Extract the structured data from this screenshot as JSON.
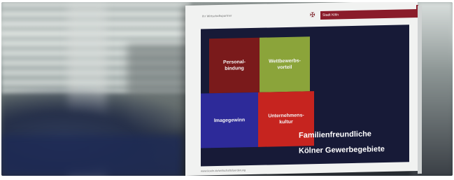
{
  "monitor": {
    "top_label": "Ihr Wirtschaftspartner",
    "brand": "Stadt Köln",
    "footer": "www.koeln.de/wirtschaftsfoerderung"
  },
  "tiles": [
    {
      "label": "Personal-\nbindung"
    },
    {
      "label": "Wettbewerbs-\nvorteil"
    },
    {
      "label": "Imagegewinn"
    },
    {
      "label": "Unternehmens-\nkultur"
    }
  ],
  "headline": {
    "line1": "Familienfreundliche",
    "line2": "Kölner Gewerbegebiete"
  },
  "colors": {
    "tile_red_dark": "#7a1a1b",
    "tile_green": "#8ba43a",
    "tile_blue": "#2d2a99",
    "tile_red": "#c6241f",
    "screen_bg": "#171a37",
    "brand": "#8a1c2a"
  }
}
